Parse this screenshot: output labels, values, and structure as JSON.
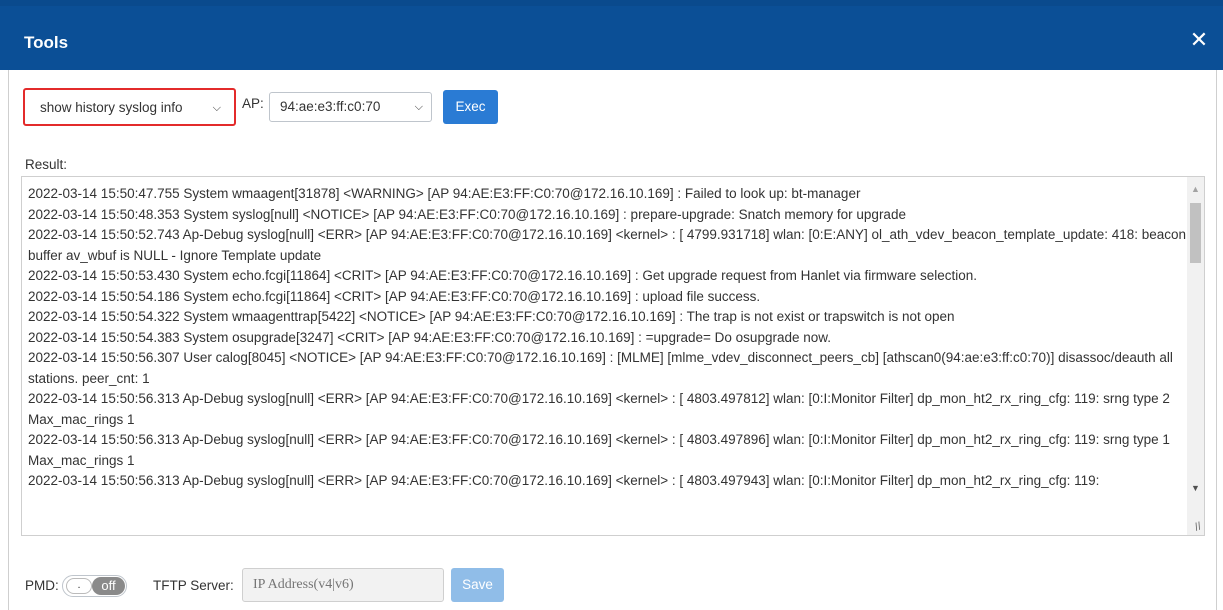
{
  "window": {
    "title": "Tools",
    "close_icon": "close-icon"
  },
  "toolbar": {
    "command_selected": "show history syslog info",
    "ap_label": "AP:",
    "ap_selected": "94:ae:e3:ff:c0:70",
    "exec_label": "Exec"
  },
  "result": {
    "label": "Result:",
    "lines": [
      "2022-03-14 15:50:47.755 System wmaagent[31878] <WARNING> [AP 94:AE:E3:FF:C0:70@172.16.10.169] : Failed to look up: bt-manager",
      "2022-03-14 15:50:48.353 System syslog[null] <NOTICE> [AP 94:AE:E3:FF:C0:70@172.16.10.169] :  prepare-upgrade: Snatch memory for upgrade",
      "2022-03-14 15:50:52.743 Ap-Debug syslog[null] <ERR> [AP 94:AE:E3:FF:C0:70@172.16.10.169] <kernel> : [ 4799.931718] wlan: [0:E:ANY] ol_ath_vdev_beacon_template_update: 418: beacon buffer av_wbuf is NULL - Ignore Template update",
      "2022-03-14 15:50:53.430 System echo.fcgi[11864] <CRIT> [AP 94:AE:E3:FF:C0:70@172.16.10.169] : Get upgrade request from Hanlet via firmware selection.",
      "2022-03-14 15:50:54.186 System echo.fcgi[11864] <CRIT> [AP 94:AE:E3:FF:C0:70@172.16.10.169] : upload file success.",
      "2022-03-14 15:50:54.322 System wmaagenttrap[5422] <NOTICE> [AP 94:AE:E3:FF:C0:70@172.16.10.169] : The trap is not exist or trapswitch is not open",
      "2022-03-14 15:50:54.383 System osupgrade[3247] <CRIT> [AP 94:AE:E3:FF:C0:70@172.16.10.169] : =upgrade= Do osupgrade now.",
      "2022-03-14 15:50:56.307 User calog[8045] <NOTICE> [AP 94:AE:E3:FF:C0:70@172.16.10.169] : [MLME] [mlme_vdev_disconnect_peers_cb] [athscan0(94:ae:e3:ff:c0:70)] disassoc/deauth all stations. peer_cnt: 1",
      "2022-03-14 15:50:56.313 Ap-Debug syslog[null] <ERR> [AP 94:AE:E3:FF:C0:70@172.16.10.169] <kernel> : [ 4803.497812] wlan: [0:I:Monitor Filter] dp_mon_ht2_rx_ring_cfg: 119: srng type 2 Max_mac_rings 1",
      "2022-03-14 15:50:56.313 Ap-Debug syslog[null] <ERR> [AP 94:AE:E3:FF:C0:70@172.16.10.169] <kernel> : [ 4803.497896] wlan: [0:I:Monitor Filter] dp_mon_ht2_rx_ring_cfg: 119: srng type 1 Max_mac_rings 1",
      "2022-03-14 15:50:56.313 Ap-Debug syslog[null] <ERR> [AP 94:AE:E3:FF:C0:70@172.16.10.169] <kernel> : [ 4803.497943] wlan: [0:I:Monitor Filter] dp_mon_ht2_rx_ring_cfg: 119:"
    ]
  },
  "footer": {
    "pmd_label": "PMD:",
    "pmd_toggle_state": "off",
    "tftp_label": "TFTP Server:",
    "tftp_placeholder": "IP Address(v4|v6)",
    "save_label": "Save"
  },
  "colors": {
    "header_bg": "#0b4f96",
    "exec_button": "#2a7bd4",
    "save_button_disabled": "#90bde8",
    "highlight_border": "#e32b2b"
  }
}
